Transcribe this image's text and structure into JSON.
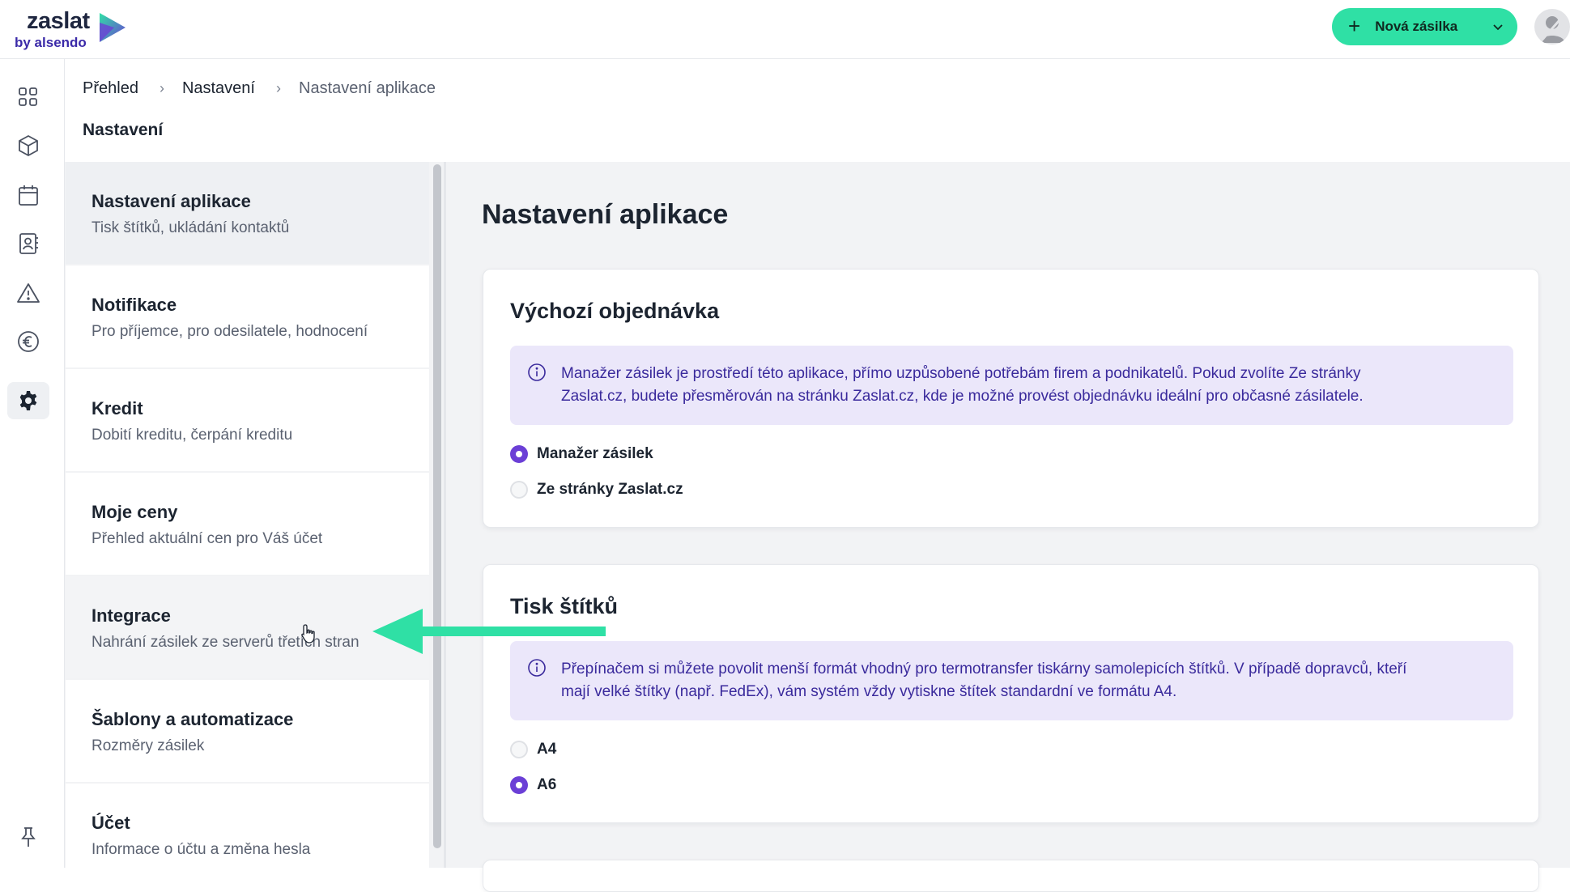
{
  "header": {
    "logo_word": "zaslat",
    "logo_sub": "by alsendo",
    "new_shipment_label": "Nová zásilka"
  },
  "breadcrumb": {
    "items": [
      "Přehled",
      "Nastavení",
      "Nastavení aplikace"
    ]
  },
  "page_title": "Nastavení",
  "settings_nav": {
    "items": [
      {
        "title": "Nastavení aplikace",
        "subtitle": "Tisk štítků, ukládání kontaktů"
      },
      {
        "title": "Notifikace",
        "subtitle": "Pro příjemce, pro odesilatele, hodnocení"
      },
      {
        "title": "Kredit",
        "subtitle": "Dobití kreditu, čerpání kreditu"
      },
      {
        "title": "Moje ceny",
        "subtitle": "Přehled aktuální cen pro Váš účet"
      },
      {
        "title": "Integrace",
        "subtitle": "Nahrání zásilek ze serverů třetích stran"
      },
      {
        "title": "Šablony a automatizace",
        "subtitle": "Rozměry zásilek"
      },
      {
        "title": "Účet",
        "subtitle": "Informace o účtu a změna hesla"
      }
    ]
  },
  "main": {
    "title": "Nastavení aplikace",
    "default_order": {
      "title": "Výchozí objednávka",
      "info_line1": "Manažer zásilek je prostředí této aplikace, přímo uzpůsobené potřebám firem a podnikatelů. Pokud zvolíte Ze stránky",
      "info_line2": "Zaslat.cz, budete přesměrován na stránku Zaslat.cz, kde je možné provést objednávku ideální pro občasné zásilatele.",
      "options": [
        "Manažer zásilek",
        "Ze stránky Zaslat.cz"
      ],
      "selected": "Manažer zásilek"
    },
    "label_print": {
      "title": "Tisk štítků",
      "info_line1": "Přepínačem si můžete povolit menší formát vhodný pro termotransfer tiskárny samolepicích štítků. V případě dopravců, kteří",
      "info_line2": "mají velké štítky (např. FedEx), vám systém vždy vytiskne štítek standardní ve formátu A4.",
      "options": [
        "A4",
        "A6"
      ],
      "selected": "A6"
    }
  },
  "colors": {
    "accent_green": "#2fe0a5",
    "accent_purple": "#6b3fd6",
    "info_bg": "#ebe7fa",
    "info_text": "#3a2a9c",
    "arrow": "#2fe0a5"
  },
  "icons": {
    "rail": [
      "dashboard-icon",
      "package-icon",
      "calendar-icon",
      "contacts-icon",
      "warning-icon",
      "euro-icon",
      "settings-icon",
      "pin-icon"
    ]
  }
}
